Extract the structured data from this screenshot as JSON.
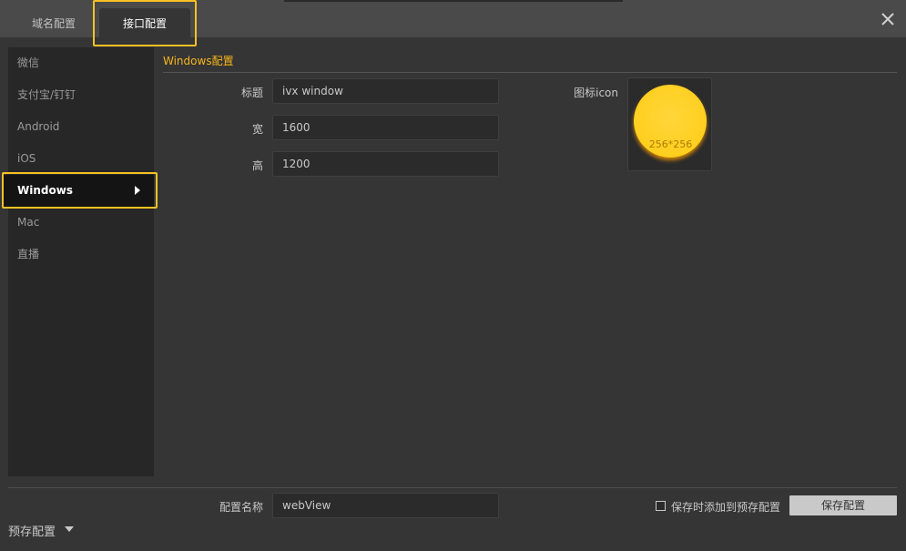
{
  "tabs": [
    {
      "label": "域名配置"
    },
    {
      "label": "接口配置"
    }
  ],
  "sidebar": {
    "items": [
      {
        "label": "微信"
      },
      {
        "label": "支付宝/钉钉"
      },
      {
        "label": "Android"
      },
      {
        "label": "iOS"
      },
      {
        "label": "Windows"
      },
      {
        "label": "Mac"
      },
      {
        "label": "直播"
      }
    ],
    "active": "Windows"
  },
  "section": {
    "title": "Windows配置"
  },
  "form": {
    "title_label": "标题",
    "title_value": "ivx window",
    "width_label": "宽",
    "width_value": "1600",
    "height_label": "高",
    "height_value": "1200",
    "icon_label": "图标icon",
    "icon_size": "256*256"
  },
  "footer": {
    "config_name_label": "配置名称",
    "config_name_value": "webView",
    "checkbox_label": "保存时添加到预存配置",
    "checkbox_checked": false,
    "save_button": "保存配置",
    "preset_label": "预存配置"
  },
  "colors": {
    "accent": "#f7b51c",
    "highlight": "#f7c124",
    "icon_yellow": "#ffcf1f"
  }
}
